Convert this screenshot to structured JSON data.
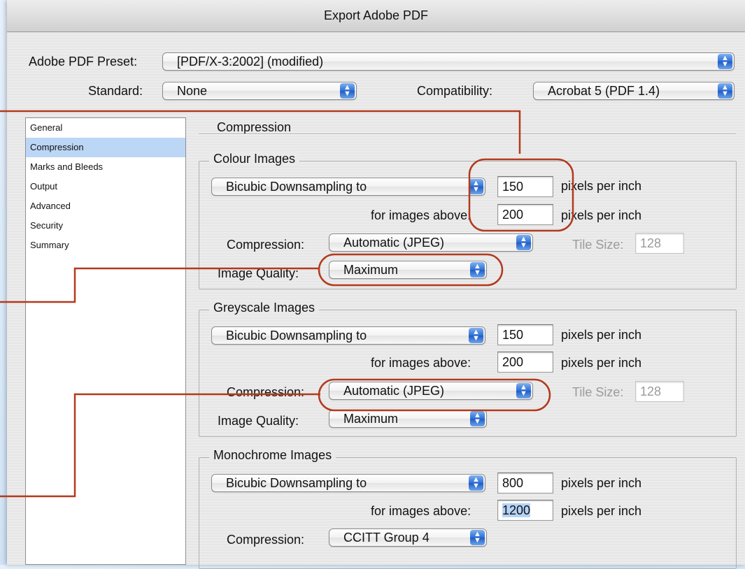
{
  "window": {
    "title": "Export Adobe PDF"
  },
  "top": {
    "preset_label": "Adobe PDF Preset:",
    "preset_value": "[PDF/X-3:2002] (modified)",
    "standard_label": "Standard:",
    "standard_value": "None",
    "compat_label": "Compatibility:",
    "compat_value": "Acrobat 5 (PDF 1.4)"
  },
  "sidebar": {
    "items": [
      {
        "label": "General"
      },
      {
        "label": "Compression",
        "active": true
      },
      {
        "label": "Marks and Bleeds"
      },
      {
        "label": "Output"
      },
      {
        "label": "Advanced"
      },
      {
        "label": "Security"
      },
      {
        "label": "Summary"
      }
    ]
  },
  "panel": {
    "title": "Compression"
  },
  "colour": {
    "title": "Colour Images",
    "downsample": "Bicubic Downsampling to",
    "ppi": "150",
    "ppi_unit": "pixels per inch",
    "above_label": "for images above:",
    "above": "200",
    "above_unit": "pixels per inch",
    "compression_label": "Compression:",
    "compression": "Automatic (JPEG)",
    "tile_label": "Tile Size:",
    "tile": "128",
    "quality_label": "Image Quality:",
    "quality": "Maximum"
  },
  "grey": {
    "title": "Greyscale Images",
    "downsample": "Bicubic Downsampling to",
    "ppi": "150",
    "ppi_unit": "pixels per inch",
    "above_label": "for images above:",
    "above": "200",
    "above_unit": "pixels per inch",
    "compression_label": "Compression:",
    "compression": "Automatic (JPEG)",
    "tile_label": "Tile Size:",
    "tile": "128",
    "quality_label": "Image Quality:",
    "quality": "Maximum"
  },
  "mono": {
    "title": "Monochrome Images",
    "downsample": "Bicubic Downsampling to",
    "ppi": "800",
    "ppi_unit": "pixels per inch",
    "above_label": "for images above:",
    "above": "1200",
    "above_unit": "pixels per inch",
    "compression_label": "Compression:",
    "compression": "CCITT Group 4"
  },
  "icons": {
    "popup_arrows": "up-down-arrows-icon"
  },
  "colors": {
    "annotation": "#b23a1e",
    "selection": "#bcd6f6",
    "popup_blue": "#2e6fd6"
  }
}
